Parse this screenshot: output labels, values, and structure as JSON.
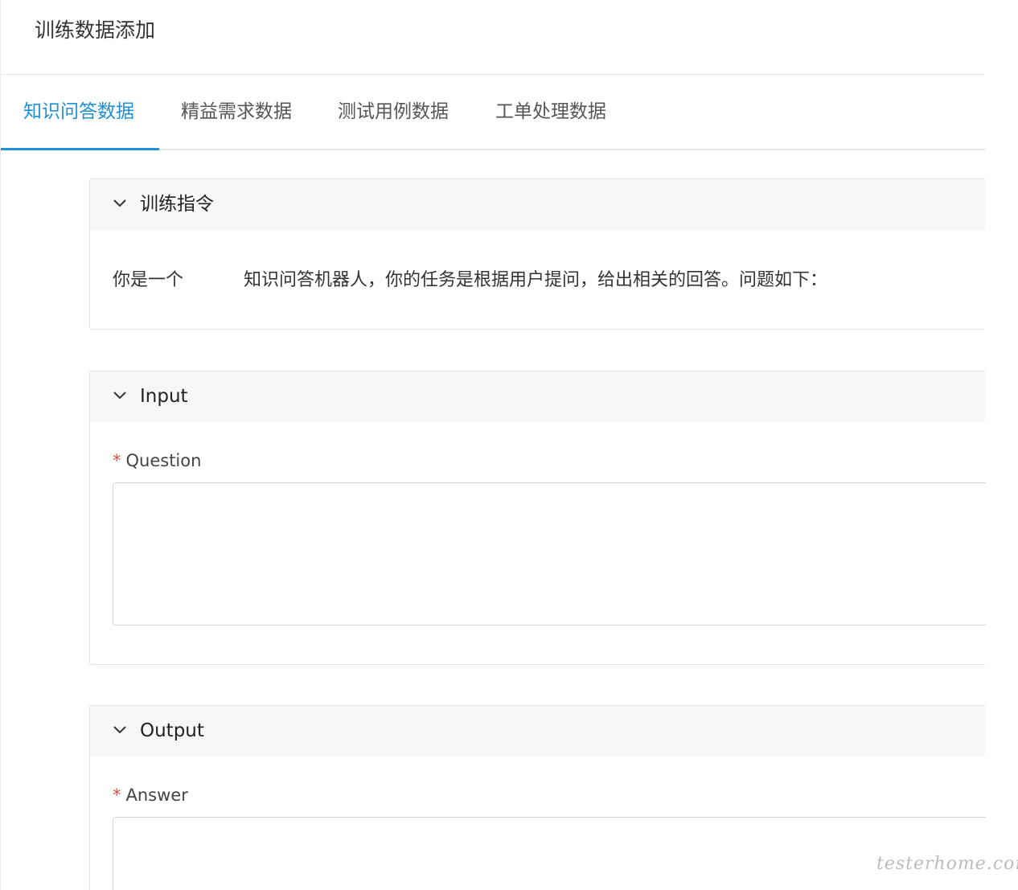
{
  "page": {
    "title": "训练数据添加"
  },
  "tabs": [
    {
      "label": "知识问答数据",
      "active": true
    },
    {
      "label": "精益需求数据",
      "active": false
    },
    {
      "label": "测试用例数据",
      "active": false
    },
    {
      "label": "工单处理数据",
      "active": false
    }
  ],
  "sections": {
    "instruction": {
      "title": "训练指令",
      "text_before": "你是一个",
      "text_after": "知识问答机器人，你的任务是根据用户提问，给出相关的回答。问题如下："
    },
    "input": {
      "title": "Input",
      "field_label": "Question",
      "required": "*",
      "value": ""
    },
    "output": {
      "title": "Output",
      "field_label": "Answer",
      "required": "*",
      "value": ""
    }
  },
  "watermark": "testerhome.com",
  "colors": {
    "accent": "#1f8fd6",
    "required": "#e04b3c",
    "panel_header": "#f7f7f7",
    "border": "#e3e3e3"
  },
  "icons": {
    "collapse": "chevron-down-icon"
  }
}
